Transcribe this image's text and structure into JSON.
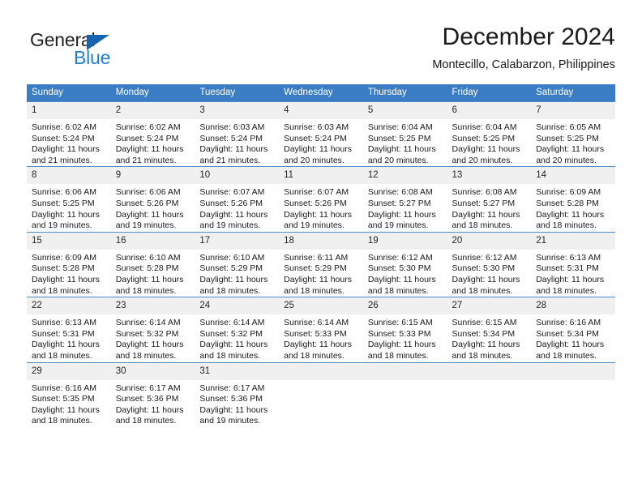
{
  "logo": {
    "primary_text": "General",
    "secondary_text": "Blue",
    "primary_color": "#231f20",
    "secondary_color": "#1e7fd4",
    "triangle_color": "#1565b0"
  },
  "header": {
    "title": "December 2024",
    "subtitle": "Montecillo, Calabarzon, Philippines"
  },
  "theme": {
    "header_bar_color": "#3b7dc4",
    "row_border_color": "#4e8ac8",
    "daynum_background": "#f0f0f0"
  },
  "calendar": {
    "weekday_headers": [
      "Sunday",
      "Monday",
      "Tuesday",
      "Wednesday",
      "Thursday",
      "Friday",
      "Saturday"
    ],
    "weeks": [
      [
        {
          "day": "1",
          "sunrise": "Sunrise: 6:02 AM",
          "sunset": "Sunset: 5:24 PM",
          "daylight_line1": "Daylight: 11 hours",
          "daylight_line2": "and 21 minutes."
        },
        {
          "day": "2",
          "sunrise": "Sunrise: 6:02 AM",
          "sunset": "Sunset: 5:24 PM",
          "daylight_line1": "Daylight: 11 hours",
          "daylight_line2": "and 21 minutes."
        },
        {
          "day": "3",
          "sunrise": "Sunrise: 6:03 AM",
          "sunset": "Sunset: 5:24 PM",
          "daylight_line1": "Daylight: 11 hours",
          "daylight_line2": "and 21 minutes."
        },
        {
          "day": "4",
          "sunrise": "Sunrise: 6:03 AM",
          "sunset": "Sunset: 5:24 PM",
          "daylight_line1": "Daylight: 11 hours",
          "daylight_line2": "and 20 minutes."
        },
        {
          "day": "5",
          "sunrise": "Sunrise: 6:04 AM",
          "sunset": "Sunset: 5:25 PM",
          "daylight_line1": "Daylight: 11 hours",
          "daylight_line2": "and 20 minutes."
        },
        {
          "day": "6",
          "sunrise": "Sunrise: 6:04 AM",
          "sunset": "Sunset: 5:25 PM",
          "daylight_line1": "Daylight: 11 hours",
          "daylight_line2": "and 20 minutes."
        },
        {
          "day": "7",
          "sunrise": "Sunrise: 6:05 AM",
          "sunset": "Sunset: 5:25 PM",
          "daylight_line1": "Daylight: 11 hours",
          "daylight_line2": "and 20 minutes."
        }
      ],
      [
        {
          "day": "8",
          "sunrise": "Sunrise: 6:06 AM",
          "sunset": "Sunset: 5:25 PM",
          "daylight_line1": "Daylight: 11 hours",
          "daylight_line2": "and 19 minutes."
        },
        {
          "day": "9",
          "sunrise": "Sunrise: 6:06 AM",
          "sunset": "Sunset: 5:26 PM",
          "daylight_line1": "Daylight: 11 hours",
          "daylight_line2": "and 19 minutes."
        },
        {
          "day": "10",
          "sunrise": "Sunrise: 6:07 AM",
          "sunset": "Sunset: 5:26 PM",
          "daylight_line1": "Daylight: 11 hours",
          "daylight_line2": "and 19 minutes."
        },
        {
          "day": "11",
          "sunrise": "Sunrise: 6:07 AM",
          "sunset": "Sunset: 5:26 PM",
          "daylight_line1": "Daylight: 11 hours",
          "daylight_line2": "and 19 minutes."
        },
        {
          "day": "12",
          "sunrise": "Sunrise: 6:08 AM",
          "sunset": "Sunset: 5:27 PM",
          "daylight_line1": "Daylight: 11 hours",
          "daylight_line2": "and 19 minutes."
        },
        {
          "day": "13",
          "sunrise": "Sunrise: 6:08 AM",
          "sunset": "Sunset: 5:27 PM",
          "daylight_line1": "Daylight: 11 hours",
          "daylight_line2": "and 18 minutes."
        },
        {
          "day": "14",
          "sunrise": "Sunrise: 6:09 AM",
          "sunset": "Sunset: 5:28 PM",
          "daylight_line1": "Daylight: 11 hours",
          "daylight_line2": "and 18 minutes."
        }
      ],
      [
        {
          "day": "15",
          "sunrise": "Sunrise: 6:09 AM",
          "sunset": "Sunset: 5:28 PM",
          "daylight_line1": "Daylight: 11 hours",
          "daylight_line2": "and 18 minutes."
        },
        {
          "day": "16",
          "sunrise": "Sunrise: 6:10 AM",
          "sunset": "Sunset: 5:28 PM",
          "daylight_line1": "Daylight: 11 hours",
          "daylight_line2": "and 18 minutes."
        },
        {
          "day": "17",
          "sunrise": "Sunrise: 6:10 AM",
          "sunset": "Sunset: 5:29 PM",
          "daylight_line1": "Daylight: 11 hours",
          "daylight_line2": "and 18 minutes."
        },
        {
          "day": "18",
          "sunrise": "Sunrise: 6:11 AM",
          "sunset": "Sunset: 5:29 PM",
          "daylight_line1": "Daylight: 11 hours",
          "daylight_line2": "and 18 minutes."
        },
        {
          "day": "19",
          "sunrise": "Sunrise: 6:12 AM",
          "sunset": "Sunset: 5:30 PM",
          "daylight_line1": "Daylight: 11 hours",
          "daylight_line2": "and 18 minutes."
        },
        {
          "day": "20",
          "sunrise": "Sunrise: 6:12 AM",
          "sunset": "Sunset: 5:30 PM",
          "daylight_line1": "Daylight: 11 hours",
          "daylight_line2": "and 18 minutes."
        },
        {
          "day": "21",
          "sunrise": "Sunrise: 6:13 AM",
          "sunset": "Sunset: 5:31 PM",
          "daylight_line1": "Daylight: 11 hours",
          "daylight_line2": "and 18 minutes."
        }
      ],
      [
        {
          "day": "22",
          "sunrise": "Sunrise: 6:13 AM",
          "sunset": "Sunset: 5:31 PM",
          "daylight_line1": "Daylight: 11 hours",
          "daylight_line2": "and 18 minutes."
        },
        {
          "day": "23",
          "sunrise": "Sunrise: 6:14 AM",
          "sunset": "Sunset: 5:32 PM",
          "daylight_line1": "Daylight: 11 hours",
          "daylight_line2": "and 18 minutes."
        },
        {
          "day": "24",
          "sunrise": "Sunrise: 6:14 AM",
          "sunset": "Sunset: 5:32 PM",
          "daylight_line1": "Daylight: 11 hours",
          "daylight_line2": "and 18 minutes."
        },
        {
          "day": "25",
          "sunrise": "Sunrise: 6:14 AM",
          "sunset": "Sunset: 5:33 PM",
          "daylight_line1": "Daylight: 11 hours",
          "daylight_line2": "and 18 minutes."
        },
        {
          "day": "26",
          "sunrise": "Sunrise: 6:15 AM",
          "sunset": "Sunset: 5:33 PM",
          "daylight_line1": "Daylight: 11 hours",
          "daylight_line2": "and 18 minutes."
        },
        {
          "day": "27",
          "sunrise": "Sunrise: 6:15 AM",
          "sunset": "Sunset: 5:34 PM",
          "daylight_line1": "Daylight: 11 hours",
          "daylight_line2": "and 18 minutes."
        },
        {
          "day": "28",
          "sunrise": "Sunrise: 6:16 AM",
          "sunset": "Sunset: 5:34 PM",
          "daylight_line1": "Daylight: 11 hours",
          "daylight_line2": "and 18 minutes."
        }
      ],
      [
        {
          "day": "29",
          "sunrise": "Sunrise: 6:16 AM",
          "sunset": "Sunset: 5:35 PM",
          "daylight_line1": "Daylight: 11 hours",
          "daylight_line2": "and 18 minutes."
        },
        {
          "day": "30",
          "sunrise": "Sunrise: 6:17 AM",
          "sunset": "Sunset: 5:36 PM",
          "daylight_line1": "Daylight: 11 hours",
          "daylight_line2": "and 18 minutes."
        },
        {
          "day": "31",
          "sunrise": "Sunrise: 6:17 AM",
          "sunset": "Sunset: 5:36 PM",
          "daylight_line1": "Daylight: 11 hours",
          "daylight_line2": "and 19 minutes."
        },
        {
          "day": "",
          "sunrise": "",
          "sunset": "",
          "daylight_line1": "",
          "daylight_line2": ""
        },
        {
          "day": "",
          "sunrise": "",
          "sunset": "",
          "daylight_line1": "",
          "daylight_line2": ""
        },
        {
          "day": "",
          "sunrise": "",
          "sunset": "",
          "daylight_line1": "",
          "daylight_line2": ""
        },
        {
          "day": "",
          "sunrise": "",
          "sunset": "",
          "daylight_line1": "",
          "daylight_line2": ""
        }
      ]
    ]
  }
}
